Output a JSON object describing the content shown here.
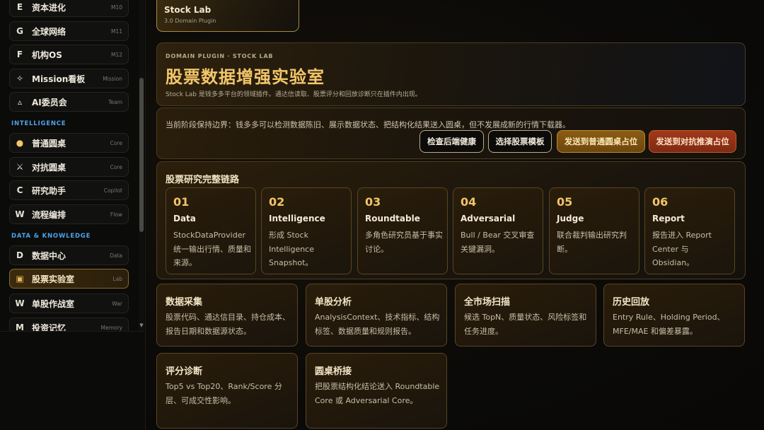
{
  "sidebar": {
    "items": [
      {
        "icon": "E",
        "label": "资本进化",
        "tag": "M10"
      },
      {
        "icon": "G",
        "label": "全球网络",
        "tag": "M11"
      },
      {
        "icon": "F",
        "label": "机构OS",
        "tag": "M12"
      },
      {
        "icon": "✧",
        "label": "Mission看板",
        "tag": "Mission"
      },
      {
        "icon": "▵",
        "label": "AI委员会",
        "tag": "Team"
      },
      {
        "icon": "●",
        "label": "普通圆桌",
        "tag": "Core"
      },
      {
        "icon": "⚔",
        "label": "对抗圆桌",
        "tag": "Core"
      },
      {
        "icon": "C",
        "label": "研究助手",
        "tag": "Copilot"
      },
      {
        "icon": "W",
        "label": "流程编排",
        "tag": "Flow"
      },
      {
        "icon": "D",
        "label": "数据中心",
        "tag": "Data"
      },
      {
        "icon": "▣",
        "label": "股票实验室",
        "tag": "Lab"
      },
      {
        "icon": "W",
        "label": "单股作战室",
        "tag": "War"
      },
      {
        "icon": "M",
        "label": "投资记忆",
        "tag": "Memory"
      }
    ],
    "sections": {
      "intelligence": "INTELLIGENCE",
      "data_knowledge": "DATA & KNOWLEDGE"
    }
  },
  "plugin_card": {
    "title": "Stock Lab",
    "subtitle": "3.0 Domain Plugin"
  },
  "hero": {
    "eyebrow": "DOMAIN PLUGIN · STOCK LAB",
    "title": "股票数据增强实验室",
    "desc": "Stock Lab 是钱多多平台的领域插件。通达信读取、股票评分和回放诊断只在插件内出现。"
  },
  "boundary": {
    "text": "当前阶段保持边界：钱多多可以检测数据陈旧、展示数据状态、把结构化结果送入圆桌，但不发展成新的行情下载器。",
    "buttons": {
      "health": "检查后端健康",
      "template": "选择股票模板",
      "send_roundtable": "发送到普通圆桌占位",
      "send_adversarial": "发送到对抗推演占位"
    }
  },
  "chain": {
    "title": "股票研究完整链路",
    "steps": [
      {
        "num": "01",
        "name": "Data",
        "desc": "StockDataProvider 统一输出行情、质量和来源。"
      },
      {
        "num": "02",
        "name": "Intelligence",
        "desc": "形成 Stock Intelligence Snapshot。"
      },
      {
        "num": "03",
        "name": "Roundtable",
        "desc": "多角色研究员基于事实讨论。"
      },
      {
        "num": "04",
        "name": "Adversarial",
        "desc": "Bull / Bear 交叉审查关键漏洞。"
      },
      {
        "num": "05",
        "name": "Judge",
        "desc": "联合裁判输出研究判断。"
      },
      {
        "num": "06",
        "name": "Report",
        "desc": "报告进入 Report Center 与 Obsidian。"
      }
    ]
  },
  "features": [
    {
      "title": "数据采集",
      "desc": "股票代码、通达信目录、持仓成本、报告日期和数据源状态。"
    },
    {
      "title": "单股分析",
      "desc": "AnalysisContext、技术指标、结构标签、数据质量和规则报告。"
    },
    {
      "title": "全市场扫描",
      "desc": "候选 TopN、质量状态、风险标签和任务进度。"
    },
    {
      "title": "历史回放",
      "desc": "Entry Rule、Holding Period、MFE/MAE 和偏差暴露。"
    },
    {
      "title": "评分诊断",
      "desc": "Top5 vs Top20、Rank/Score 分层、可成交性影响。"
    },
    {
      "title": "圆桌桥接",
      "desc": "把股票结构化结论送入 Roundtable Core 或 Adversarial Core。"
    }
  ],
  "colors": {
    "accent_gold": "#f2c66a",
    "section_blue": "#4da3e8",
    "danger": "#a1391a"
  }
}
